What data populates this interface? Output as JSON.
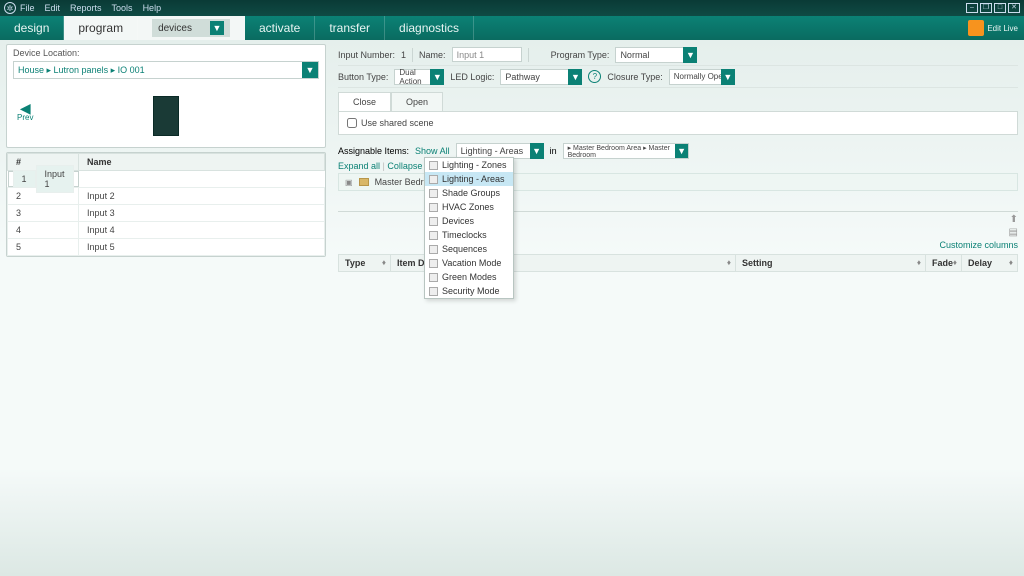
{
  "menu": {
    "file": "File",
    "edit": "Edit",
    "reports": "Reports",
    "tools": "Tools",
    "help": "Help"
  },
  "tabs": {
    "design": "design",
    "program": "program",
    "activate": "activate",
    "transfer": "transfer",
    "diagnostics": "diagnostics"
  },
  "device_dropdown": "devices",
  "edit_live": "Edit Live",
  "sidebar": {
    "location_label": "Device Location:",
    "location_value": "House ▸ Lutron panels ▸ IO 001",
    "prev": "Prev",
    "col_num": "#",
    "col_name": "Name",
    "rows": [
      {
        "n": "1",
        "name": "Input 1"
      },
      {
        "n": "2",
        "name": "Input 2"
      },
      {
        "n": "3",
        "name": "Input 3"
      },
      {
        "n": "4",
        "name": "Input 4"
      },
      {
        "n": "5",
        "name": "Input 5"
      }
    ]
  },
  "form": {
    "input_number_label": "Input Number:",
    "input_number_value": "1",
    "name_label": "Name:",
    "name_value": "Input 1",
    "program_type_label": "Program Type:",
    "program_type_value": "Normal",
    "button_type_label": "Button Type:",
    "button_type_value": "Dual Action",
    "led_logic_label": "LED Logic:",
    "led_logic_value": "Pathway",
    "closure_type_label": "Closure Type:",
    "closure_type_value": "Normally Open"
  },
  "subtabs": {
    "close": "Close",
    "open": "Open"
  },
  "shared_scene": "Use shared scene",
  "assign": {
    "label": "Assignable Items:",
    "show_all": "Show All",
    "filter_value": "Lighting - Areas",
    "in": "in",
    "scope": "▸ Master Bedroom Area ▸ Master Bedroom",
    "expand": "Expand all",
    "collapse": "Collapse all",
    "tree_item": "Master Bedroom"
  },
  "dropdown_options": [
    "Lighting - Zones",
    "Lighting - Areas",
    "Shade Groups",
    "HVAC Zones",
    "Devices",
    "Timeclocks",
    "Sequences",
    "Vacation Mode",
    "Green Modes",
    "Security Mode"
  ],
  "customize": "Customize columns",
  "results_cols": {
    "type": "Type",
    "desc": "Item Description",
    "setting": "Setting",
    "fade": "Fade",
    "delay": "Delay"
  }
}
